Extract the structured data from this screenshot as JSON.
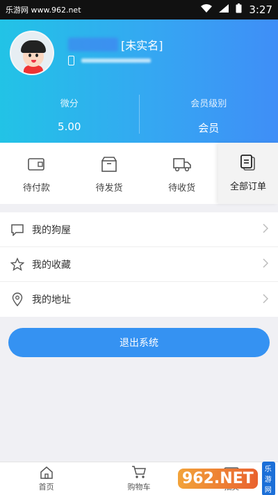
{
  "status_bar": {
    "left_text": "乐游网 www.962.net",
    "time": "3:27"
  },
  "profile": {
    "name_suffix": "[未实名]"
  },
  "stats": [
    {
      "label": "微分",
      "value": "5.00"
    },
    {
      "label": "会员级别",
      "value": "会员"
    }
  ],
  "orders": {
    "items": [
      {
        "label": "待付款",
        "icon": "wallet-icon"
      },
      {
        "label": "待发货",
        "icon": "box-icon"
      },
      {
        "label": "待收货",
        "icon": "truck-icon"
      },
      {
        "label": "全部订单",
        "icon": "orders-icon"
      }
    ]
  },
  "menu": {
    "items": [
      {
        "label": "我的狗屋",
        "icon": "chat-icon"
      },
      {
        "label": "我的收藏",
        "icon": "star-icon"
      },
      {
        "label": "我的地址",
        "icon": "location-icon"
      }
    ]
  },
  "logout_label": "退出系统",
  "tabbar": {
    "items": [
      {
        "label": "首页",
        "icon": "home-icon"
      },
      {
        "label": "购物车",
        "icon": "cart-icon"
      },
      {
        "label": "抽奖",
        "icon": "lottery-icon"
      }
    ]
  },
  "watermark": {
    "logo": "962.NET",
    "subtitle": "乐游网"
  },
  "colors": {
    "header_start": "#22c3e6",
    "header_end": "#3f8ef7",
    "accent": "#3592f2"
  }
}
